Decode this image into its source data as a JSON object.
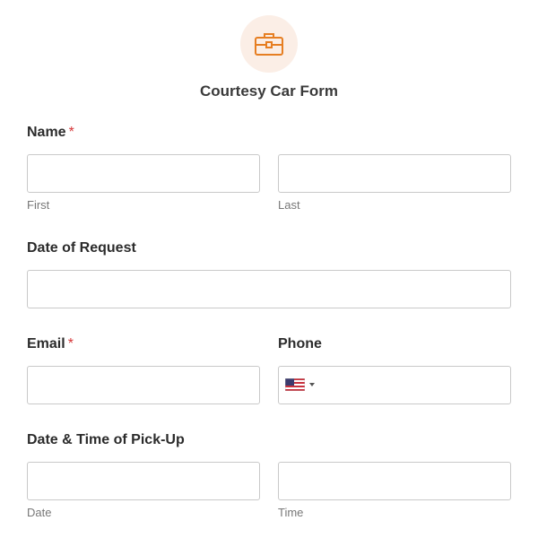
{
  "form": {
    "icon": "briefcase-icon",
    "accent_color": "#e67e22",
    "icon_bg_color": "#fbeee6",
    "title": "Courtesy Car Form",
    "required_marker": "*"
  },
  "fields": {
    "name": {
      "label": "Name",
      "required": true,
      "first_sublabel": "First",
      "last_sublabel": "Last",
      "first_value": "",
      "last_value": ""
    },
    "date_of_request": {
      "label": "Date of Request",
      "value": ""
    },
    "email": {
      "label": "Email",
      "required": true,
      "value": ""
    },
    "phone": {
      "label": "Phone",
      "country_flag": "us-flag-icon",
      "value": ""
    },
    "pickup": {
      "label": "Date & Time of Pick-Up",
      "date_sublabel": "Date",
      "time_sublabel": "Time",
      "date_value": "",
      "time_value": ""
    }
  }
}
